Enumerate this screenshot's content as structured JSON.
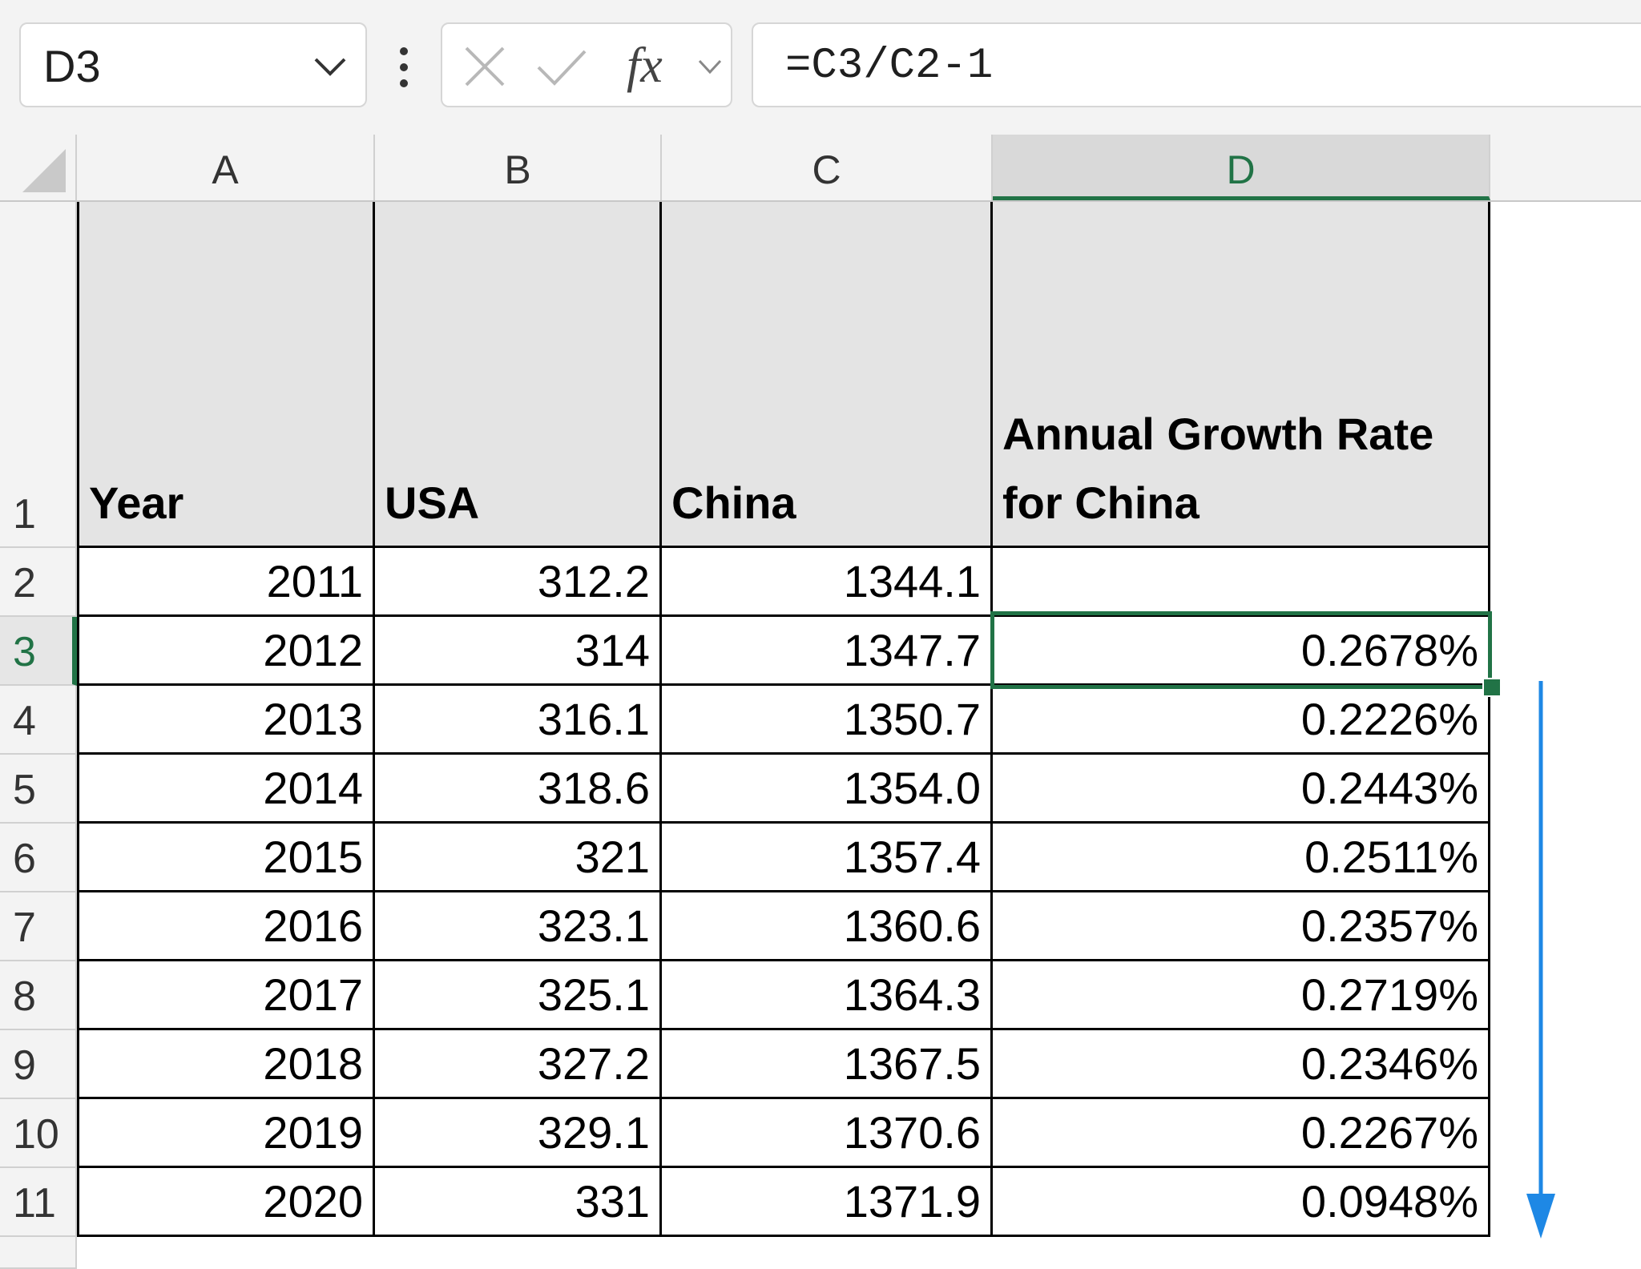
{
  "namebox": {
    "value": "D3"
  },
  "formula_bar": {
    "fx_label": "fx",
    "formula": "=C3/C2-1"
  },
  "columns": [
    "A",
    "B",
    "C",
    "D"
  ],
  "selected_cell": "D3",
  "rows": [
    "1",
    "2",
    "3",
    "4",
    "5",
    "6",
    "7",
    "8",
    "9",
    "10",
    "11"
  ],
  "headers": {
    "year": "Year",
    "usa": "USA",
    "china": "China",
    "growth": "Annual Growth Rate for China"
  },
  "data": [
    {
      "year": "2011",
      "usa": "312.2",
      "china": "1344.1",
      "growth": ""
    },
    {
      "year": "2012",
      "usa": "314",
      "china": "1347.7",
      "growth": "0.2678%"
    },
    {
      "year": "2013",
      "usa": "316.1",
      "china": "1350.7",
      "growth": "0.2226%"
    },
    {
      "year": "2014",
      "usa": "318.6",
      "china": "1354.0",
      "growth": "0.2443%"
    },
    {
      "year": "2015",
      "usa": "321",
      "china": "1357.4",
      "growth": "0.2511%"
    },
    {
      "year": "2016",
      "usa": "323.1",
      "china": "1360.6",
      "growth": "0.2357%"
    },
    {
      "year": "2017",
      "usa": "325.1",
      "china": "1364.3",
      "growth": "0.2719%"
    },
    {
      "year": "2018",
      "usa": "327.2",
      "china": "1367.5",
      "growth": "0.2346%"
    },
    {
      "year": "2019",
      "usa": "329.1",
      "china": "1370.6",
      "growth": "0.2267%"
    },
    {
      "year": "2020",
      "usa": "331",
      "china": "1371.9",
      "growth": "0.0948%"
    }
  ],
  "colors": {
    "selection": "#217346",
    "fill_arrow": "#1e88e5",
    "header_fill": "#e4e4e4"
  }
}
